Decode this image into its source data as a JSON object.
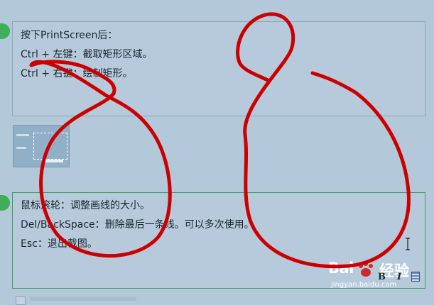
{
  "box1": {
    "lines": [
      "按下PrintScreen后：",
      "Ctrl + 左键：截取矩形区域。",
      "Ctrl + 右键：绘制矩形。"
    ]
  },
  "box2": {
    "lines": [
      "鼠标滚轮：调整画线的大小。",
      "Del/BackSpace：删除最后一条线。可以多次使用。",
      "Esc：退出截图。"
    ]
  },
  "format": {
    "bold_label": "B",
    "italic_label": "I"
  },
  "watermark": {
    "brand": "Bai",
    "brand2": "经验",
    "url": "jingyan.baidu.com"
  },
  "colors": {
    "background": "#b3c8d9",
    "annotation_stroke": "#cc0000",
    "step_dot": "#3fae5b"
  },
  "icons": [
    "image-insert-icon",
    "text-cursor-icon",
    "baidu-paw-icon"
  ]
}
